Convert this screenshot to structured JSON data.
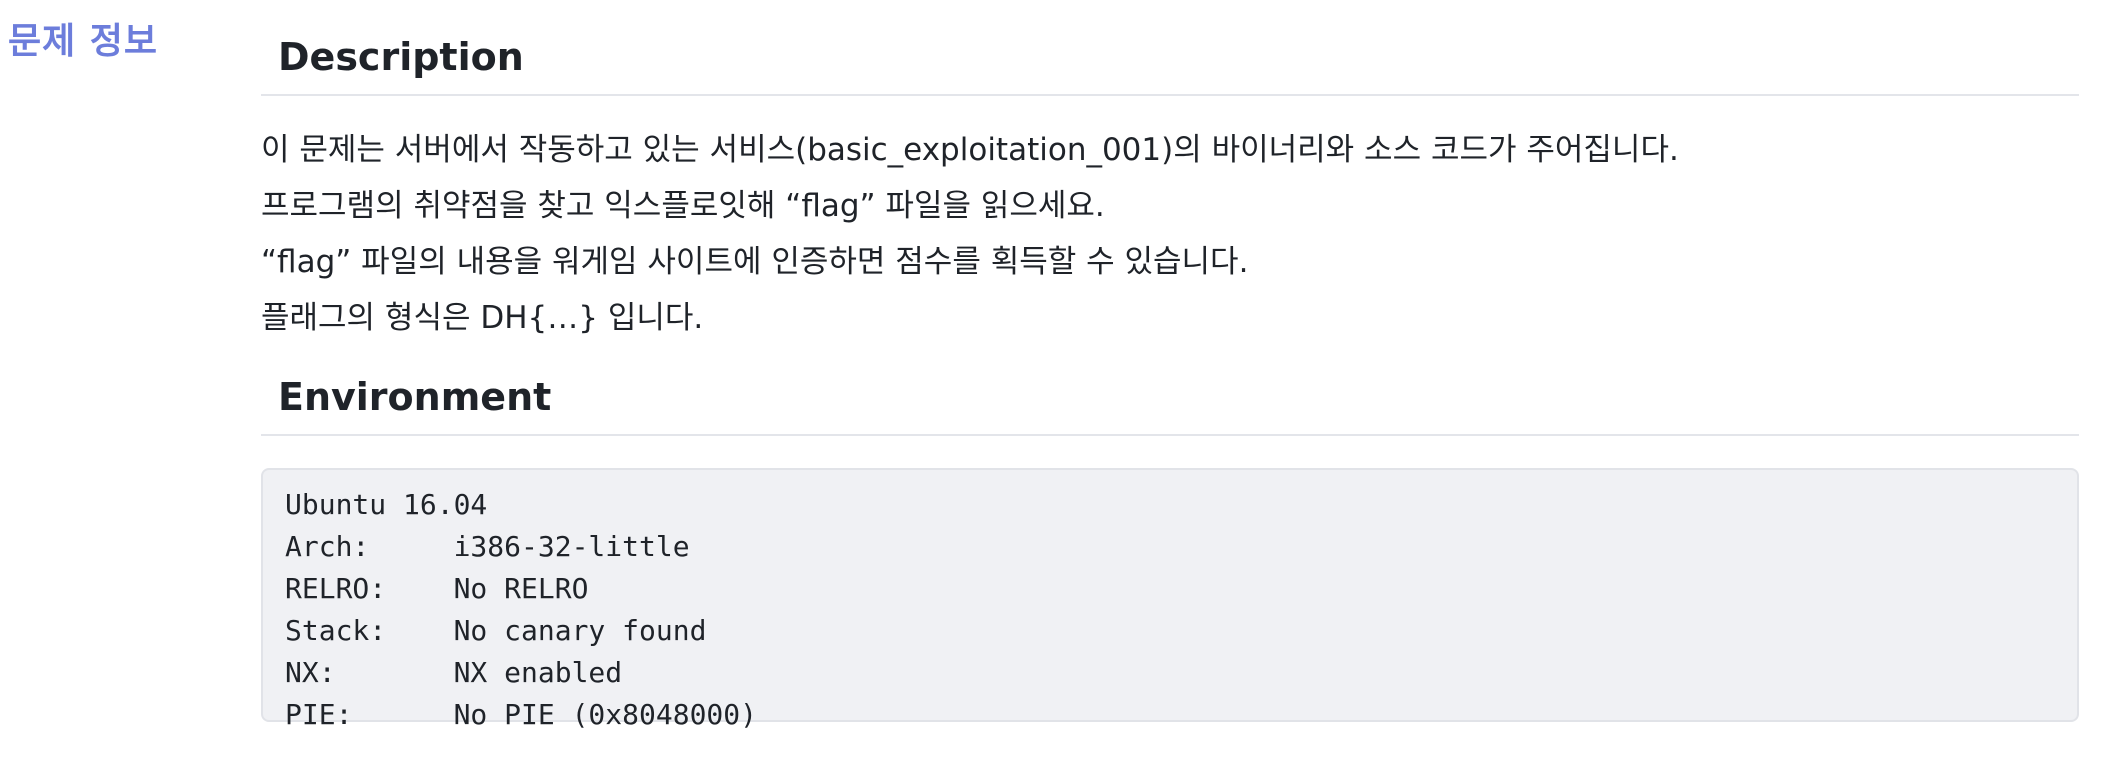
{
  "section": {
    "label": "문제 정보"
  },
  "description": {
    "heading": "Description",
    "lines": [
      "이 문제는 서버에서 작동하고 있는 서비스(basic_exploitation_001)의 바이너리와 소스 코드가 주어집니다.",
      "프로그램의 취약점을 찾고 익스플로잇해 “flag” 파일을 읽으세요.",
      "“flag” 파일의 내용을 워게임 사이트에 인증하면 점수를 획득할 수 있습니다.",
      "플래그의 형식은 DH{…} 입니다."
    ]
  },
  "environment": {
    "heading": "Environment",
    "code_lines": [
      "Ubuntu 16.04",
      "Arch:     i386-32-little",
      "RELRO:    No RELRO",
      "Stack:    No canary found",
      "NX:       NX enabled",
      "PIE:      No PIE (0x8048000)"
    ]
  }
}
